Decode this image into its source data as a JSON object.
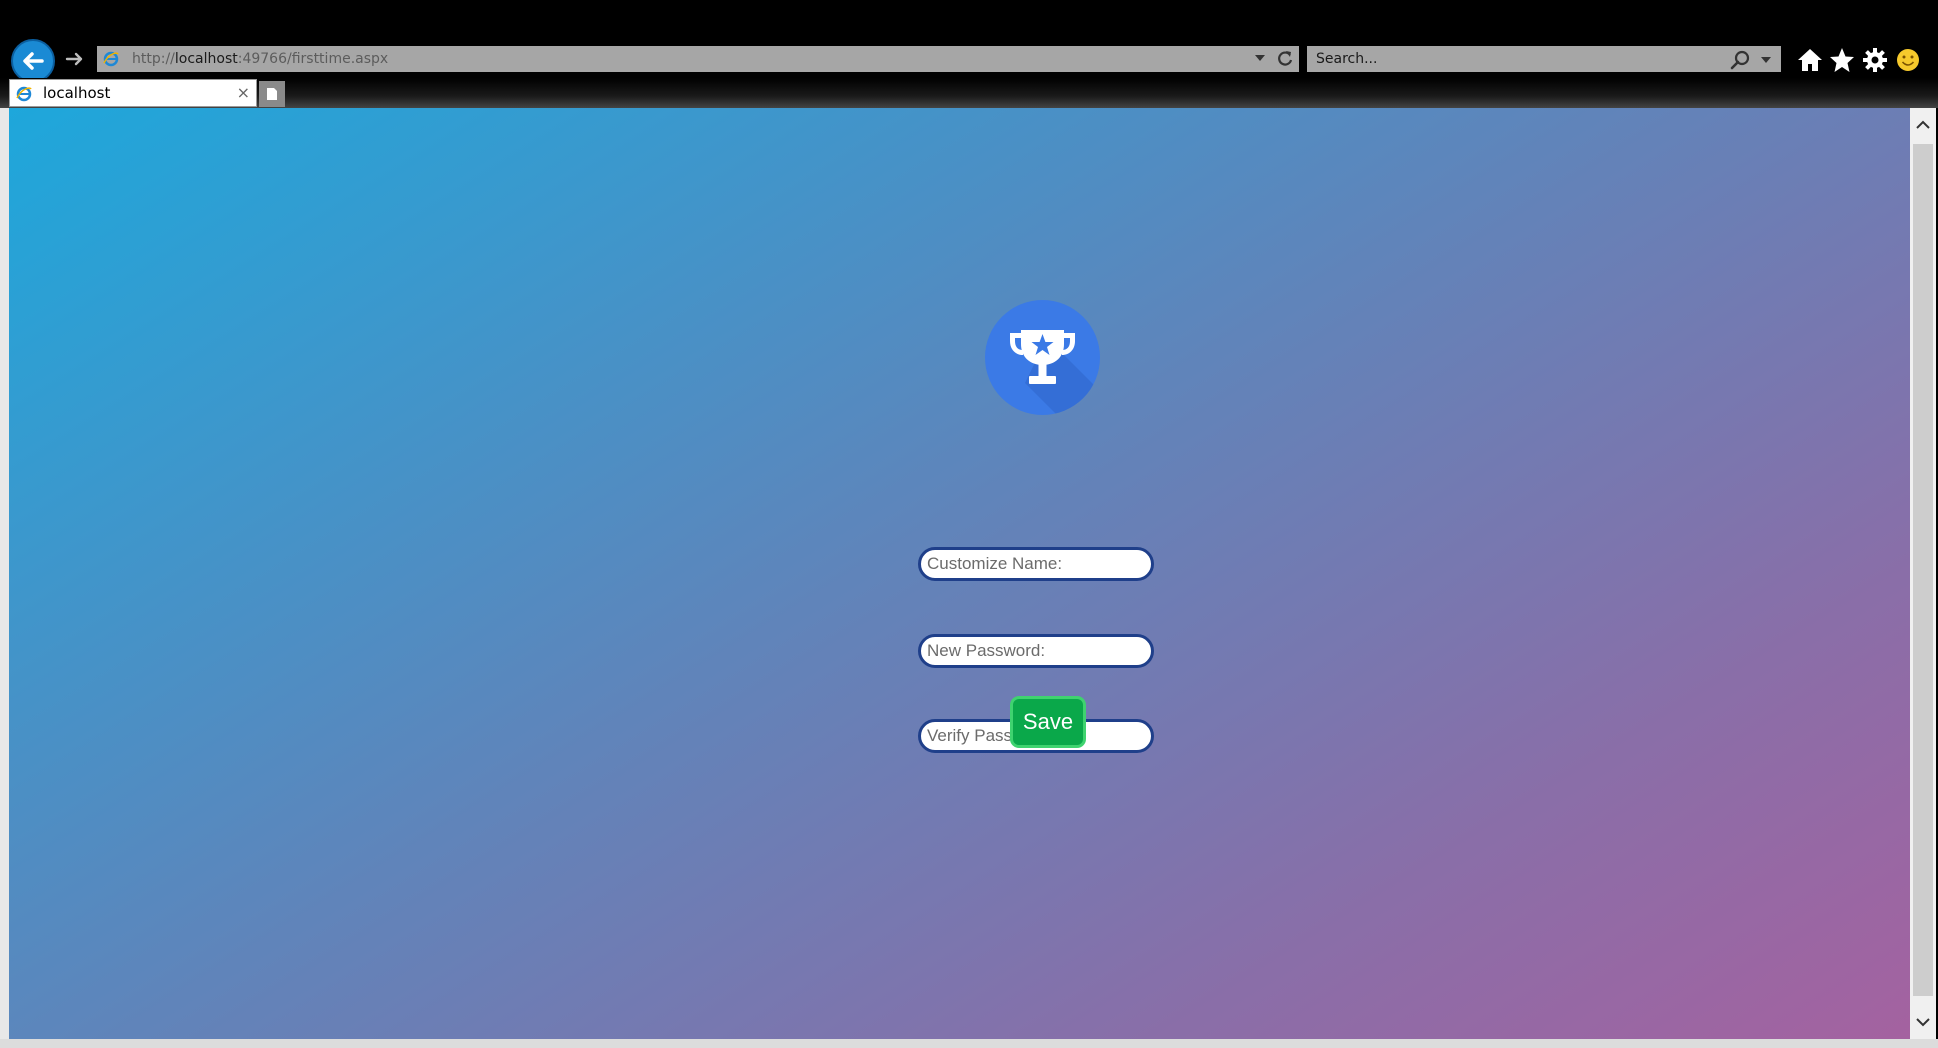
{
  "browser": {
    "address": {
      "protocol": "http://",
      "host": "localhost",
      "rest": ":49766/firsttime.aspx"
    },
    "search_placeholder": "Search...",
    "tab": {
      "label": "localhost",
      "close": "×"
    },
    "icons": {
      "back": "back-arrow-icon",
      "forward": "forward-arrow-icon",
      "refresh": "refresh-icon",
      "search": "search-icon",
      "home": "home-icon",
      "favorites": "star-icon",
      "settings": "gear-icon",
      "feedback": "smiley-icon"
    }
  },
  "page": {
    "logo_icon": "trophy-star-icon",
    "fields": {
      "name_placeholder": "Customize Name:",
      "new_password_placeholder": "New Password:",
      "verify_password_placeholder": "Verify Password:"
    },
    "save_label": "Save"
  },
  "colors": {
    "gradient_start": "#1ea7db",
    "gradient_end": "#a462a0",
    "trophy_circle": "#3b7ae6",
    "field_border": "#1f3f8a",
    "save_button": "#0aa84a"
  }
}
